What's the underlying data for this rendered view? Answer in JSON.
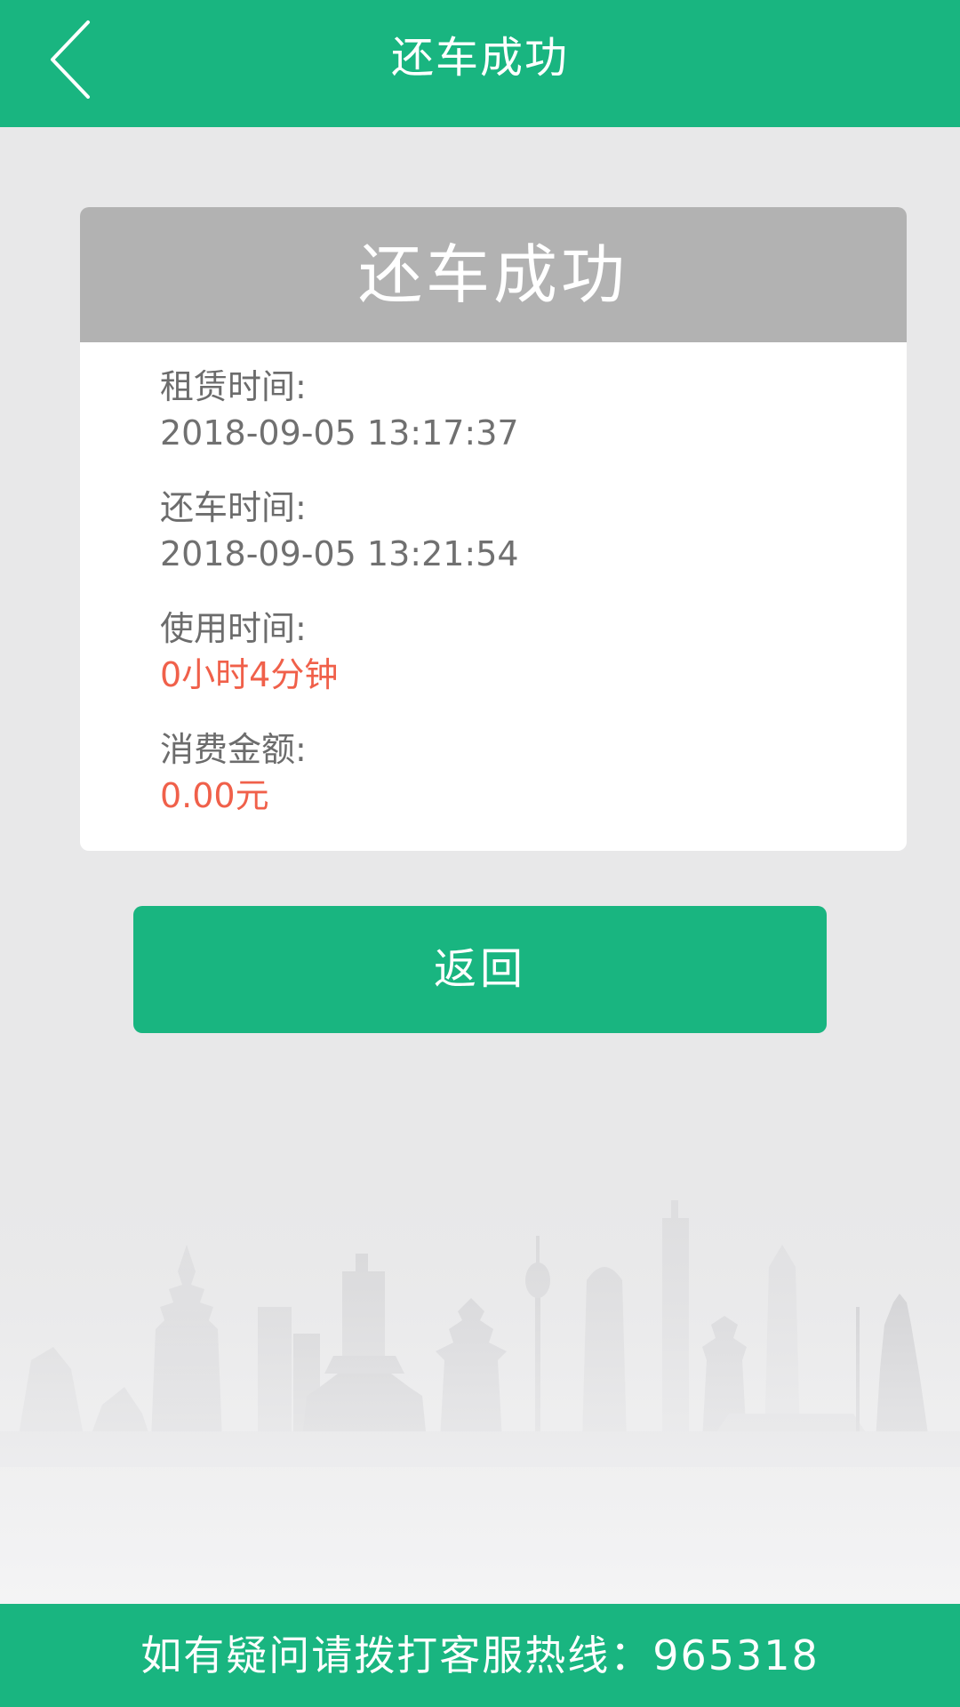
{
  "header": {
    "title": "还车成功",
    "back_icon": "chevron-left-icon"
  },
  "card": {
    "title": "还车成功",
    "fields": [
      {
        "label": "租赁时间:",
        "value": "2018-09-05 13:17:37"
      },
      {
        "label": "还车时间:",
        "value": "2018-09-05 13:21:54"
      },
      {
        "label": "使用时间:",
        "value": "0小时4分钟"
      },
      {
        "label": "消费金额:",
        "value": "0.00元"
      }
    ]
  },
  "actions": {
    "return_label": "返回"
  },
  "footer": {
    "hotline_text": "如有疑问请拨打客服热线：965318"
  },
  "colors": {
    "brand_green": "#19b580",
    "header_gray": "#b2b2b2",
    "highlight_red": "#f0604a",
    "background": "#e8e8e9"
  }
}
